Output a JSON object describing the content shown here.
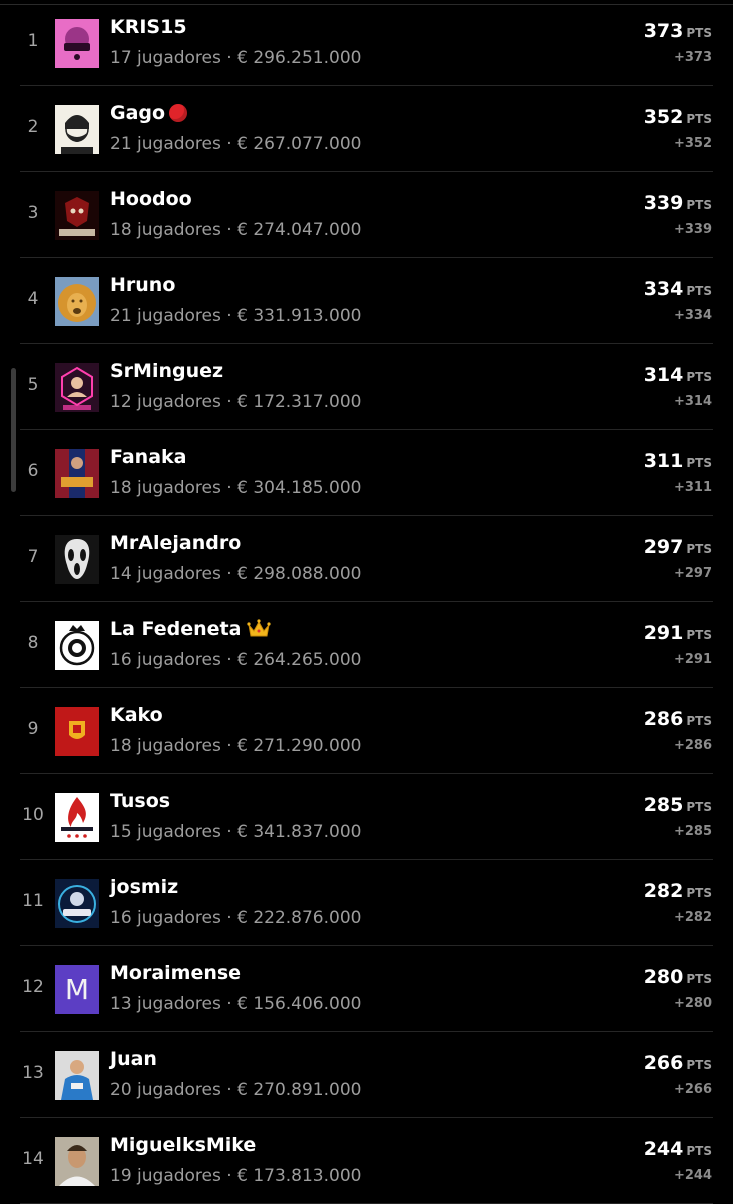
{
  "standings": {
    "unit_label": "PTS",
    "rows": [
      {
        "rank": "1",
        "name": "KRIS15",
        "badge": null,
        "players": "17 jugadores",
        "value": "€ 296.251.000",
        "points": "373",
        "delta": "+373",
        "avatar_icon": "kris15-logo-avatar",
        "avatar_colors": [
          "#e86dc6",
          "#7a1e6c"
        ]
      },
      {
        "rank": "2",
        "name": "Gago",
        "badge": "red-circle-icon",
        "players": "21 jugadores",
        "value": "€ 267.077.000",
        "points": "352",
        "delta": "+352",
        "avatar_icon": "bearded-man-sketch-avatar",
        "avatar_colors": [
          "#f2efe6",
          "#222222"
        ]
      },
      {
        "rank": "3",
        "name": "Hoodoo",
        "badge": null,
        "players": "18 jugadores",
        "value": "€ 274.047.000",
        "points": "339",
        "delta": "+339",
        "avatar_icon": "hoodoo-logo-avatar",
        "avatar_colors": [
          "#8a1515",
          "#e8d8c0"
        ]
      },
      {
        "rank": "4",
        "name": "Hruno",
        "badge": null,
        "players": "21 jugadores",
        "value": "€ 331.913.000",
        "points": "334",
        "delta": "+334",
        "avatar_icon": "lion-avatar",
        "avatar_colors": [
          "#d6942e",
          "#5a3a10"
        ]
      },
      {
        "rank": "5",
        "name": "SrMinguez",
        "badge": null,
        "players": "12 jugadores",
        "value": "€ 172.317.000",
        "points": "314",
        "delta": "+314",
        "avatar_icon": "srminguez-neon-avatar",
        "avatar_colors": [
          "#2a0d24",
          "#ff3fae"
        ]
      },
      {
        "rank": "6",
        "name": "Fanaka",
        "badge": null,
        "players": "18 jugadores",
        "value": "€ 304.185.000",
        "points": "311",
        "delta": "+311",
        "avatar_icon": "dios-football-avatar",
        "avatar_colors": [
          "#1a2a6a",
          "#e0a030"
        ]
      },
      {
        "rank": "7",
        "name": "MrAlejandro",
        "badge": null,
        "players": "14 jugadores",
        "value": "€ 298.088.000",
        "points": "297",
        "delta": "+297",
        "avatar_icon": "ghostface-mask-avatar",
        "avatar_colors": [
          "#141414",
          "#e6e6e6"
        ]
      },
      {
        "rank": "8",
        "name": "La Fedeneta",
        "badge": "crown-icon",
        "players": "16 jugadores",
        "value": "€ 264.265.000",
        "points": "291",
        "delta": "+291",
        "avatar_icon": "crest-emblem-avatar",
        "avatar_colors": [
          "#ffffff",
          "#111111"
        ]
      },
      {
        "rank": "9",
        "name": "Kako",
        "badge": null,
        "players": "18 jugadores",
        "value": "€ 271.290.000",
        "points": "286",
        "delta": "+286",
        "avatar_icon": "spain-crest-avatar",
        "avatar_colors": [
          "#c01818",
          "#f0b020"
        ]
      },
      {
        "rank": "10",
        "name": "Tusos",
        "badge": null,
        "players": "15 jugadores",
        "value": "€ 341.837.000",
        "points": "285",
        "delta": "+285",
        "avatar_icon": "flame-logo-avatar",
        "avatar_colors": [
          "#ffffff",
          "#d02020"
        ]
      },
      {
        "rank": "11",
        "name": "josmiz",
        "badge": null,
        "players": "16 jugadores",
        "value": "€ 222.876.000",
        "points": "282",
        "delta": "+282",
        "avatar_icon": "josmiz-logo-avatar",
        "avatar_colors": [
          "#0b1b3a",
          "#3ab0e0"
        ]
      },
      {
        "rank": "12",
        "name": "Moraimense",
        "badge": null,
        "players": "13 jugadores",
        "value": "€ 156.406.000",
        "points": "280",
        "delta": "+280",
        "avatar_icon": "letter-m-avatar",
        "avatar_letter": "M",
        "avatar_colors": [
          "#5c3ec4",
          "#f2f2f2"
        ]
      },
      {
        "rank": "13",
        "name": "Juan",
        "badge": null,
        "players": "20 jugadores",
        "value": "€ 270.891.000",
        "points": "266",
        "delta": "+266",
        "avatar_icon": "football-player-photo-avatar",
        "avatar_colors": [
          "#2a7ac8",
          "#f0f0f0"
        ]
      },
      {
        "rank": "14",
        "name": "MiguelksMike",
        "badge": null,
        "players": "19 jugadores",
        "value": "€ 173.813.000",
        "points": "244",
        "delta": "+244",
        "avatar_icon": "man-portrait-photo-avatar",
        "avatar_colors": [
          "#b8b0a0",
          "#3a2a1a"
        ]
      }
    ]
  }
}
